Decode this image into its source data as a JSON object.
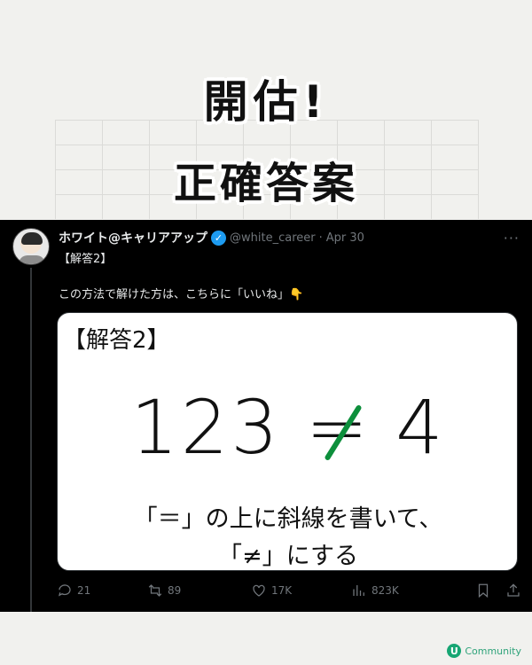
{
  "headline": {
    "line1": "開估!",
    "line2": "正確答案"
  },
  "tweet": {
    "name": "ホワイト@キャリアアップ",
    "handle": "@white_career",
    "date": "Apr 30",
    "separator": "·",
    "more": "···",
    "line1": "【解答2】",
    "line2": "この方法で解けた方は、こちらに「いいね」👇",
    "media": {
      "label": "【解答2】",
      "eq_left": "123",
      "eq_symbol": "=",
      "eq_right": "4",
      "caption1": "「＝」の上に斜線を書いて、",
      "caption2": "「≠」にする"
    },
    "stats": {
      "replies": "21",
      "retweets": "89",
      "likes": "17K",
      "views": "823K"
    }
  },
  "brand": {
    "logo": "U",
    "name": "Community"
  }
}
